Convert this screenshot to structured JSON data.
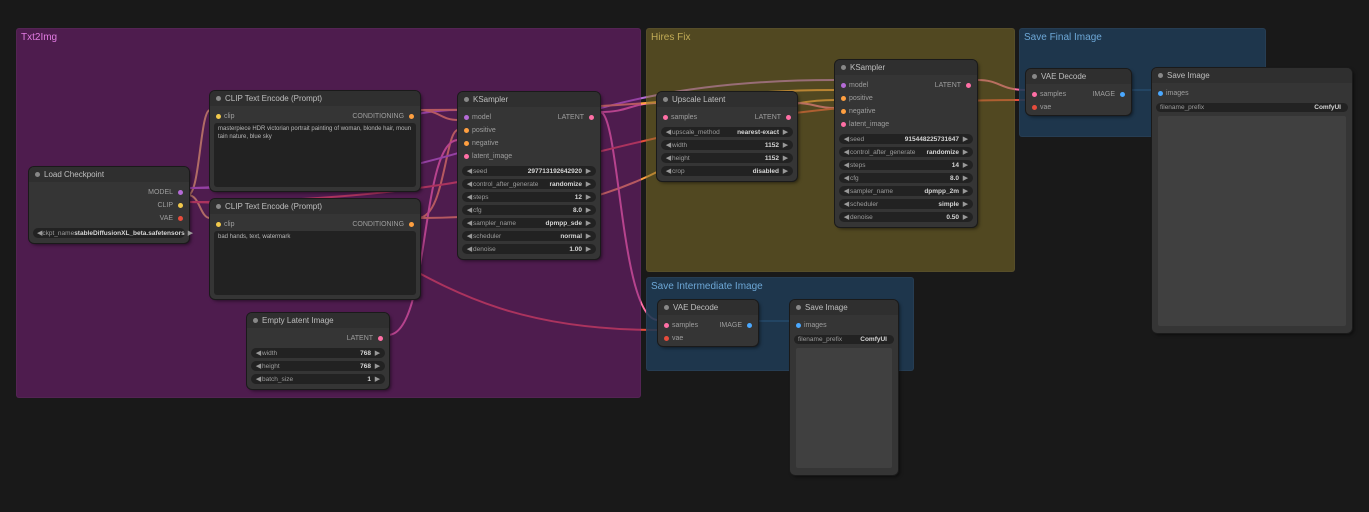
{
  "groups": {
    "txt2img": {
      "title": "Txt2Img",
      "bg": "#7a1f7a",
      "title_color": "#e27be2"
    },
    "hires": {
      "title": "Hires Fix",
      "bg": "#807028",
      "title_color": "#c1ab56"
    },
    "save_final": {
      "title": "Save Final Image",
      "bg": "#1f3a52",
      "title_color": "#6da7d6"
    },
    "save_inter": {
      "title": "Save Intermediate Image",
      "bg": "#1f3a52",
      "title_color": "#6da7d6"
    }
  },
  "nodes": {
    "load_ckpt": {
      "title": "Load Checkpoint",
      "widgets": [
        {
          "label": "ckpt_name",
          "value": "stableDiffusionXL_beta.safetensors"
        }
      ]
    },
    "clip_pos": {
      "title": "CLIP Text Encode (Prompt)",
      "text": "masterpiece HDR victorian portrait painting of woman, blonde hair, mountain nature, blue sky"
    },
    "clip_neg": {
      "title": "CLIP Text Encode (Prompt)",
      "text": "bad hands, text, watermark"
    },
    "latent": {
      "title": "Empty Latent Image",
      "widgets": [
        {
          "label": "width",
          "value": "768"
        },
        {
          "label": "height",
          "value": "768"
        },
        {
          "label": "batch_size",
          "value": "1"
        }
      ]
    },
    "ksampler1": {
      "title": "KSampler",
      "widgets": [
        {
          "label": "seed",
          "value": "297713192642920"
        },
        {
          "label": "control_after_generate",
          "value": "randomize"
        },
        {
          "label": "steps",
          "value": "12"
        },
        {
          "label": "cfg",
          "value": "8.0"
        },
        {
          "label": "sampler_name",
          "value": "dpmpp_sde"
        },
        {
          "label": "scheduler",
          "value": "normal"
        },
        {
          "label": "denoise",
          "value": "1.00"
        }
      ]
    },
    "upscale": {
      "title": "Upscale Latent",
      "widgets": [
        {
          "label": "upscale_method",
          "value": "nearest-exact"
        },
        {
          "label": "width",
          "value": "1152"
        },
        {
          "label": "height",
          "value": "1152"
        },
        {
          "label": "crop",
          "value": "disabled"
        }
      ]
    },
    "ksampler2": {
      "title": "KSampler",
      "widgets": [
        {
          "label": "seed",
          "value": "915448225731647"
        },
        {
          "label": "control_after_generate",
          "value": "randomize"
        },
        {
          "label": "steps",
          "value": "14"
        },
        {
          "label": "cfg",
          "value": "8.0"
        },
        {
          "label": "sampler_name",
          "value": "dpmpp_2m"
        },
        {
          "label": "scheduler",
          "value": "simple"
        },
        {
          "label": "denoise",
          "value": "0.50"
        }
      ]
    },
    "vae1": {
      "title": "VAE Decode"
    },
    "save1": {
      "title": "Save Image",
      "widgets": [
        {
          "label": "filename_prefix",
          "value": "ComfyUI"
        }
      ]
    },
    "vae2": {
      "title": "VAE Decode"
    },
    "save2": {
      "title": "Save Image",
      "widgets": [
        {
          "label": "filename_prefix",
          "value": "ComfyUI"
        }
      ]
    }
  }
}
